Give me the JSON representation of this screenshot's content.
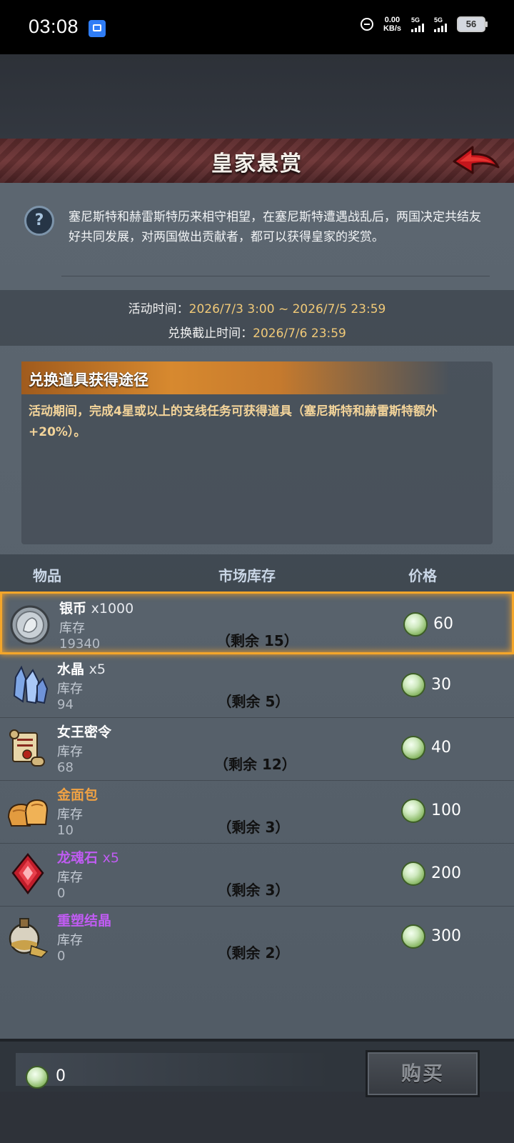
{
  "status_bar": {
    "time": "03:08",
    "net_speed": "0.00",
    "net_unit": "KB/s",
    "sim1": "5G",
    "sim2": "5G",
    "battery": "56"
  },
  "header": {
    "title": "皇家悬赏"
  },
  "description": "塞尼斯特和赫雷斯特历来相守相望，在塞尼斯特遭遇战乱后，两国决定共结友好共同发展，对两国做出贡献者，都可以获得皇家的奖赏。",
  "event_time": {
    "label": "活动时间：",
    "value": "2026/7/3 3:00 ~ 2026/7/5 23:59",
    "deadline_label": "兑换截止时间：",
    "deadline_value": "2026/7/6 23:59"
  },
  "route": {
    "title": "兑换道具获得途径",
    "text": "活动期间，完成4星或以上的支线任务可获得道具（塞尼斯特和赫雷斯特额外+20%）。"
  },
  "table": {
    "col_item": "物品",
    "col_market": "市场库存",
    "col_price": "价格",
    "stock_label": "库存",
    "rows": [
      {
        "name": "银币",
        "qty": "x1000",
        "stock": "19340",
        "market": "（剩余 15）",
        "price": "60"
      },
      {
        "name": "水晶",
        "qty": "x5",
        "stock": "94",
        "market": "（剩余 5）",
        "price": "30"
      },
      {
        "name": "女王密令",
        "qty": "",
        "stock": "68",
        "market": "（剩余 12）",
        "price": "40"
      },
      {
        "name": "金面包",
        "qty": "",
        "stock": "10",
        "market": "（剩余 3）",
        "price": "100"
      },
      {
        "name": "龙魂石",
        "qty": "x5",
        "stock": "0",
        "market": "（剩余 3）",
        "price": "200"
      },
      {
        "name": "重塑结晶",
        "qty": "",
        "stock": "0",
        "market": "（剩余 2）",
        "price": "300"
      }
    ]
  },
  "footer": {
    "balance": "0",
    "buy_label": "购买"
  },
  "colors": {
    "accent_orange": "#f4a62a",
    "title_bar": "#6e3536",
    "route_text": "#f3d49a",
    "rare_purple": "#c05cf2",
    "rare_orange": "#f0a244"
  }
}
